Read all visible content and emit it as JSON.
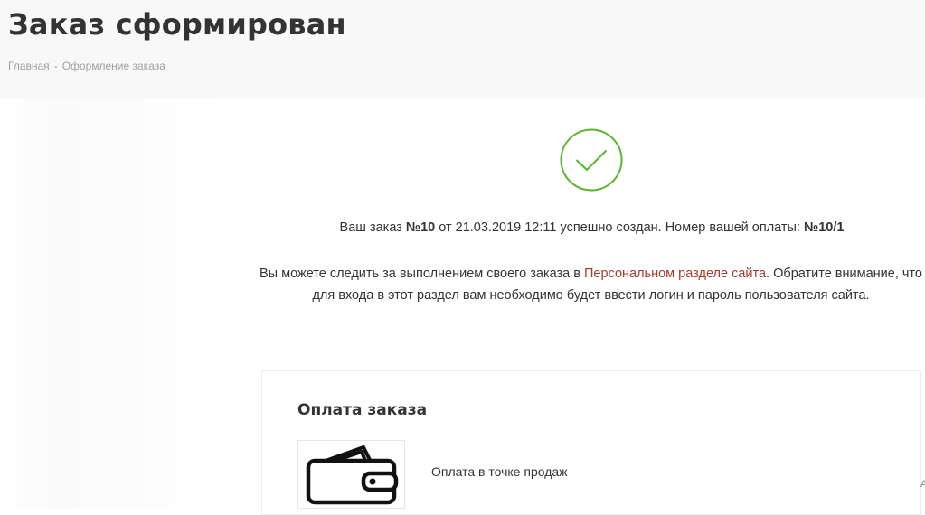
{
  "header": {
    "title": "Заказ сформирован",
    "breadcrumb": {
      "home": "Главная",
      "separator": "-",
      "current": "Оформление заказа"
    }
  },
  "confirmation": {
    "icon": "checkmark-circle-icon",
    "accent_color": "#5ab531",
    "order_prefix": "Ваш заказ ",
    "order_number": "№10",
    "order_middle": " от 21.03.2019 12:11 успешно создан. Номер вашей оплаты: ",
    "payment_number": "№10/1",
    "info_before_link": "Вы можете следить за выполнением своего заказа в ",
    "info_link": "Персональном разделе сайта",
    "info_after_link": ". Обратите внимание, что для входа в этот раздел вам необходимо будет ввести логин и пароль пользователя сайта.",
    "link_color": "#a33a2e"
  },
  "payment": {
    "title": "Оплата заказа",
    "method_icon": "wallet-icon",
    "method_name": "Оплата в точке продаж",
    "edge_glyph": "A"
  }
}
